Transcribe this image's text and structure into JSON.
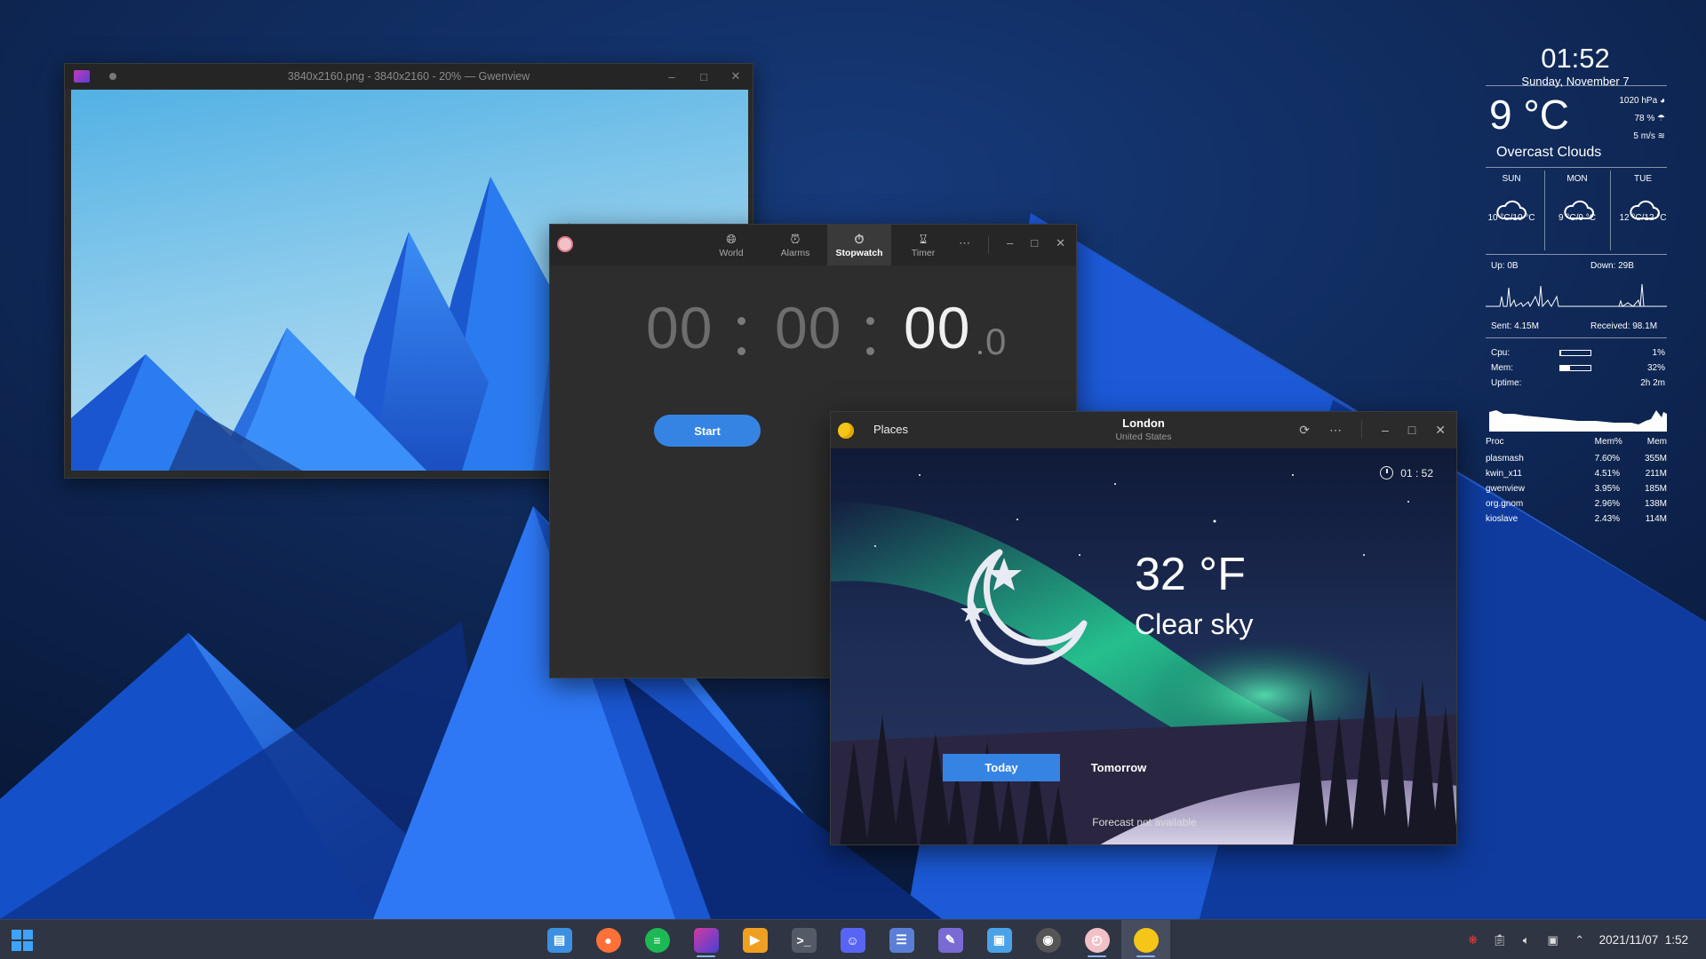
{
  "gwenview": {
    "title": "3840x2160.png - 3840x2160 - 20% — Gwenview"
  },
  "clocks": {
    "tabs": [
      {
        "label": "World",
        "icon": "globe-icon"
      },
      {
        "label": "Alarms",
        "icon": "alarm-icon"
      },
      {
        "label": "Stopwatch",
        "icon": "stopwatch-icon",
        "active": true
      },
      {
        "label": "Timer",
        "icon": "hourglass-icon"
      }
    ],
    "stopwatch": {
      "hours": "00",
      "minutes": "00",
      "seconds": "00",
      "tenths": "0"
    },
    "start_label": "Start"
  },
  "weather": {
    "places_label": "Places",
    "city": "London",
    "country": "United States",
    "time": "01 : 52",
    "temperature": "32 °F",
    "condition": "Clear sky",
    "today_label": "Today",
    "tomorrow_label": "Tomorrow",
    "forecast_message": "Forecast not available"
  },
  "conky": {
    "time": "01:52",
    "date": "Sunday, November 7",
    "temperature": "9 °C",
    "pressure": "1020 hPa",
    "humidity": "78 %",
    "wind": "5 m/s",
    "condition": "Overcast Clouds",
    "forecast": [
      {
        "day": "SUN",
        "temps": "10 °C/10 °C",
        "icon": "cloud-icon"
      },
      {
        "day": "MON",
        "temps": "9 °C/9 °C",
        "icon": "cloud-icon"
      },
      {
        "day": "TUE",
        "temps": "12 °C/12 °C",
        "icon": "cloud-icon"
      }
    ],
    "net": {
      "up": "Up: 0B",
      "down": "Down: 29B",
      "sent": "Sent: 4.15M",
      "received": "Received: 98.1M"
    },
    "sys": {
      "cpu_label": "Cpu:",
      "cpu_value": "1%",
      "cpu_fraction": 0.01,
      "mem_label": "Mem:",
      "mem_value": "32%",
      "mem_fraction": 0.32,
      "uptime_label": "Uptime:",
      "uptime_value": "2h 2m"
    },
    "proc_headers": [
      "Proc",
      "Mem%",
      "Mem"
    ],
    "processes": [
      [
        "plasmash",
        "7.60%",
        "355M"
      ],
      [
        "kwin_x11",
        "4.51%",
        "211M"
      ],
      [
        "gwenview",
        "3.95%",
        "185M"
      ],
      [
        "org.gnom",
        "2.96%",
        "138M"
      ],
      [
        "kioslave",
        "2.43%",
        "114M"
      ]
    ]
  },
  "taskbar": {
    "apps": [
      {
        "name": "file-manager-icon",
        "color": "#3d8fe0"
      },
      {
        "name": "firefox-icon",
        "color": "#ff7139"
      },
      {
        "name": "spotify-icon",
        "color": "#1db954"
      },
      {
        "name": "gwenview-icon",
        "color": "#b83aa8",
        "active": true
      },
      {
        "name": "slides-icon",
        "color": "#f0a020"
      },
      {
        "name": "terminal-icon",
        "color": "#555b66"
      },
      {
        "name": "discord-icon",
        "color": "#5865f2"
      },
      {
        "name": "document-icon",
        "color": "#5b7fd6"
      },
      {
        "name": "text-editor-icon",
        "color": "#7a6bd4"
      },
      {
        "name": "store-icon",
        "color": "#4aa3e8"
      },
      {
        "name": "settings-icon",
        "color": "#555"
      },
      {
        "name": "clocks-icon",
        "color": "#f2c1c8",
        "active": true
      },
      {
        "name": "weather-icon",
        "color": "#f5c518",
        "active": true,
        "focused": true
      }
    ],
    "datetime": "2021/11/07  1:52"
  }
}
